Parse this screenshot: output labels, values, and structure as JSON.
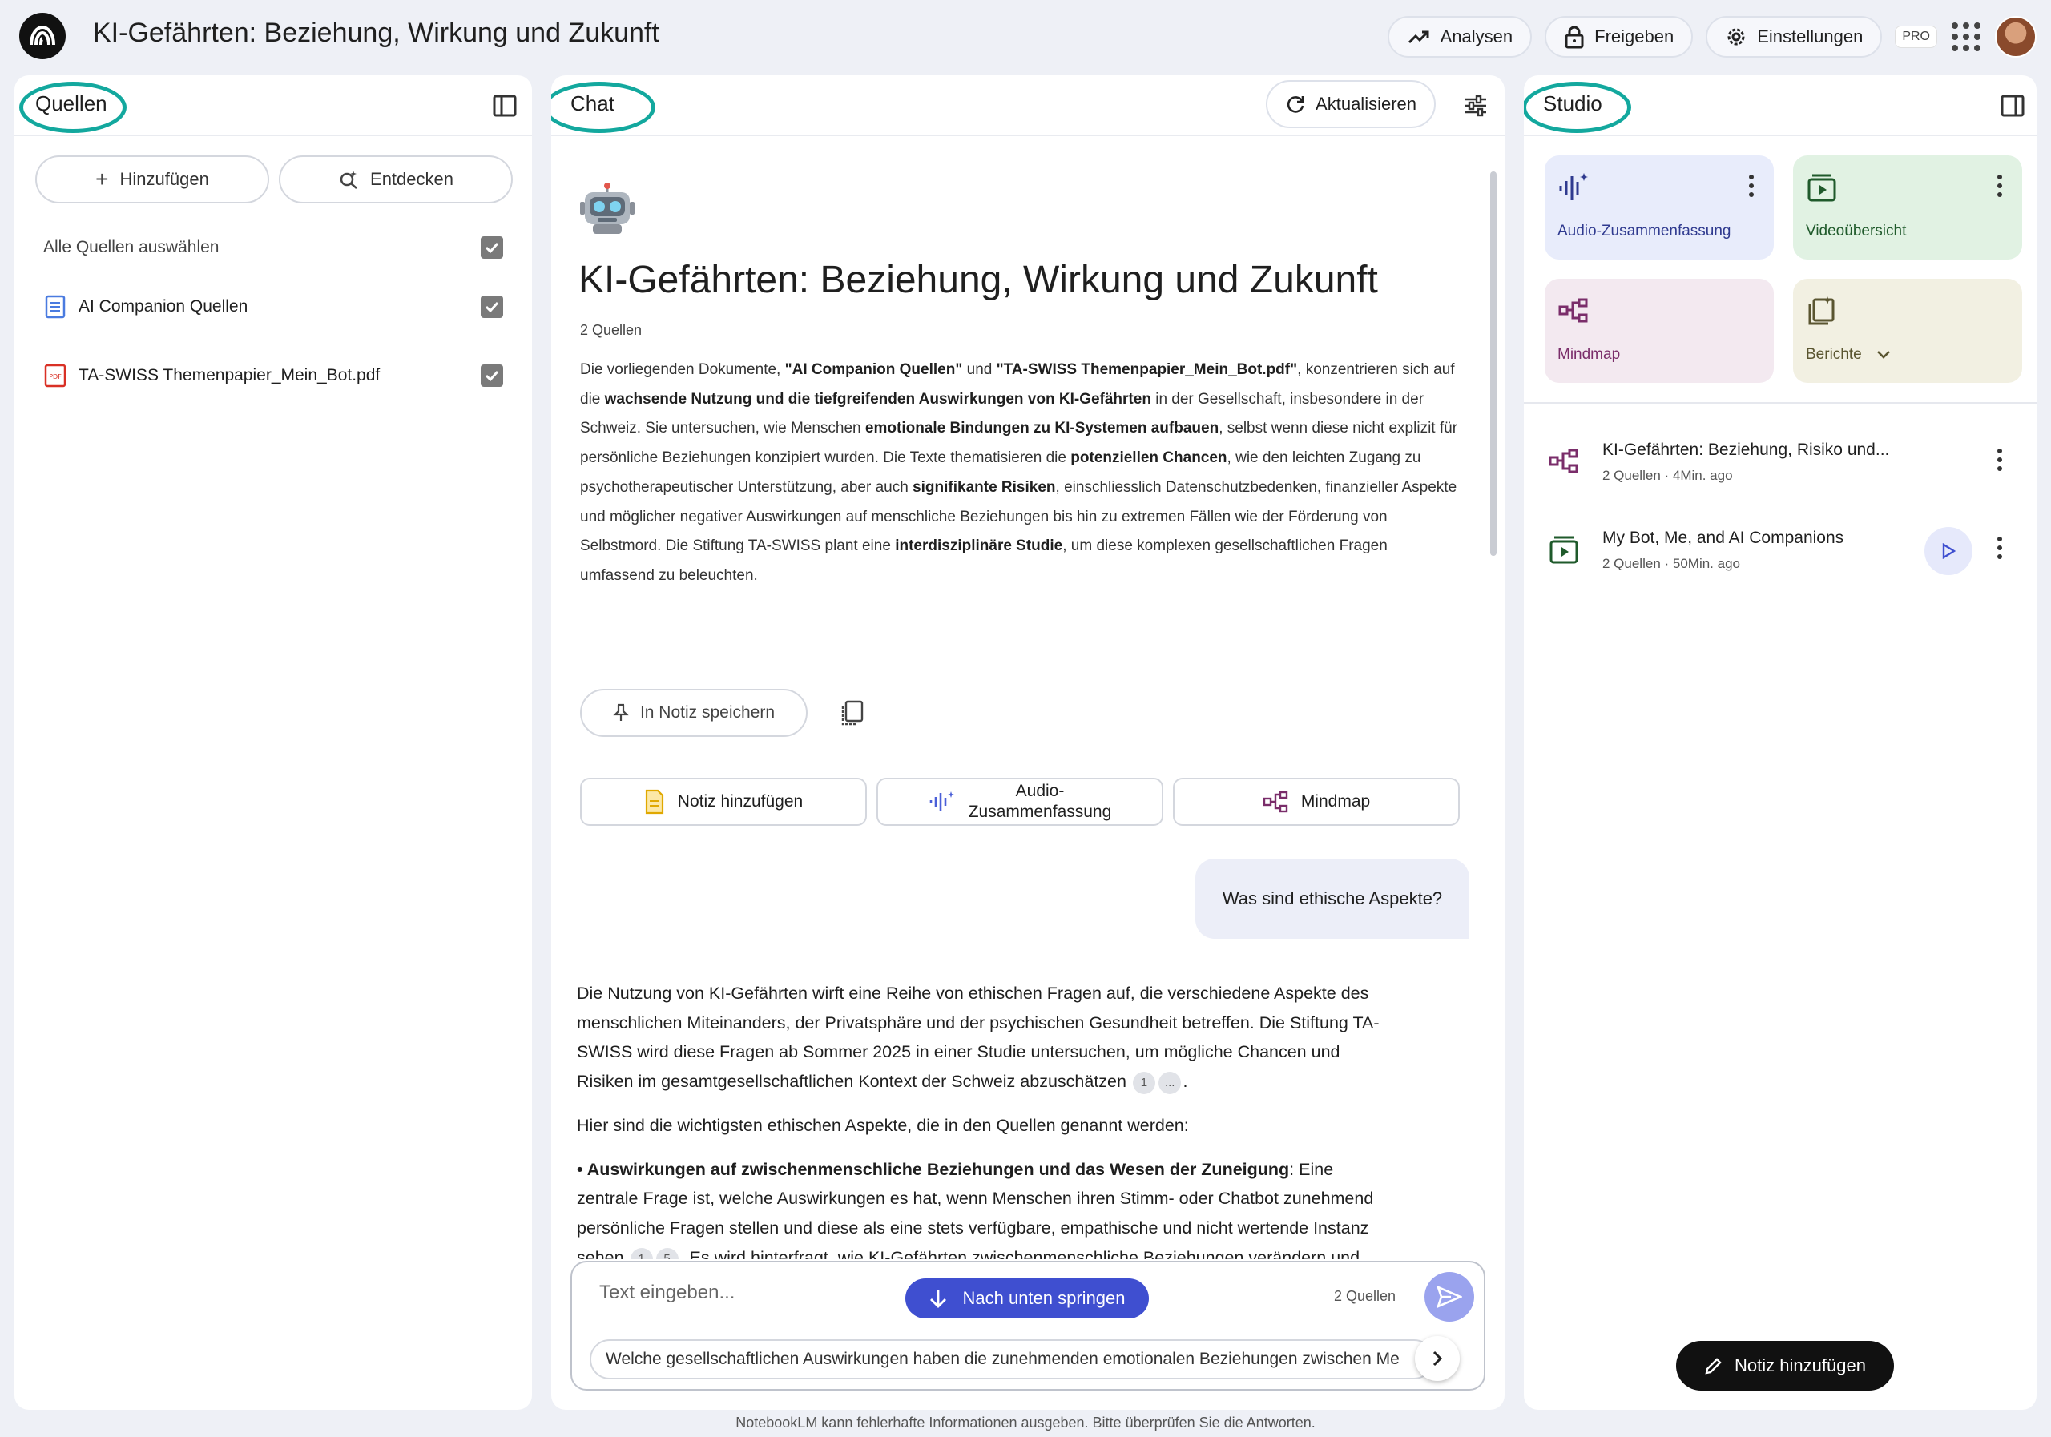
{
  "app": {
    "title": "KI-Gefährten: Beziehung, Wirkung und Zukunft"
  },
  "topbar": {
    "analytics_label": "Analysen",
    "share_label": "Freigeben",
    "settings_label": "Einstellungen",
    "plan_badge": "PRO"
  },
  "sources": {
    "title": "Quellen",
    "add_label": "Hinzufügen",
    "discover_label": "Entdecken",
    "select_all_label": "Alle Quellen auswählen",
    "items": [
      {
        "label": "AI Companion Quellen",
        "icon": "document-icon",
        "checked": true
      },
      {
        "label": "TA-SWISS Themenpapier_Mein_Bot.pdf",
        "icon": "pdf-icon",
        "checked": true
      }
    ]
  },
  "chat": {
    "title": "Chat",
    "refresh_label": "Aktualisieren",
    "notebook_emoji": "robot-icon",
    "notebook_title": "KI-Gefährten: Beziehung, Wirkung und Zukunft",
    "source_count": "2 Quellen",
    "summary": {
      "t1": "Die vorliegenden Dokumente, ",
      "b1": "\"AI Companion Quellen\"",
      "t2": " und ",
      "b2": "\"TA-SWISS Themenpapier_Mein_Bot.pdf\"",
      "t3": ", konzentrieren sich auf die ",
      "b3": "wachsende Nutzung und die tiefgreifenden Auswirkungen von KI-Gefährten",
      "t4": " in der Gesellschaft, insbesondere in der Schweiz. Sie untersuchen, wie Menschen ",
      "b4": "emotionale Bindungen zu KI-Systemen aufbauen",
      "t5": ", selbst wenn diese nicht explizit für persönliche Beziehungen konzipiert wurden. Die Texte thematisieren die ",
      "b5": "potenziellen Chancen",
      "t6": ", wie den leichten Zugang zu psychotherapeutischer Unterstützung, aber auch ",
      "b6": "signifikante Risiken",
      "t7": ", einschliesslich Datenschutzbedenken, finanzieller Aspekte und möglicher negativer Auswirkungen auf menschliche Beziehungen bis hin zu extremen Fällen wie der Förderung von Selbstmord. Die Stiftung TA-SWISS plant eine ",
      "b7": "interdisziplinäre Studie",
      "t8": ", um diese komplexen gesellschaftlichen Fragen umfassend zu beleuchten."
    },
    "save_note_label": "In Notiz speichern",
    "suggestions": [
      {
        "label": "Notiz hinzufügen",
        "icon": "note-icon"
      },
      {
        "label": "Audio-\nZusammenfassung",
        "icon": "audio-icon"
      },
      {
        "label": "Mindmap",
        "icon": "mindmap-icon"
      }
    ],
    "user_question": "Was sind ethische Aspekte?",
    "answer": {
      "p1": "Die Nutzung von KI-Gefährten wirft eine Reihe von ethischen Fragen auf, die verschiedene Aspekte des menschlichen Miteinanders, der Privatsphäre und der psychischen Gesundheit betreffen. Die Stiftung TA-SWISS wird diese Fragen ab Sommer 2025 in einer Studie untersuchen, um mögliche Chancen und Risiken im gesamtgesellschaftlichen Kontext der Schweiz abzuschätzen",
      "p1_cites": [
        "1",
        "..."
      ],
      "p1_end": ".",
      "p2": "Hier sind die wichtigsten ethischen Aspekte, die in den Quellen genannt werden:",
      "p3_bullet": "• ",
      "p3_bold": "Auswirkungen auf zwischenmenschliche Beziehungen und das Wesen der Zuneigung",
      "p3_a": ": Eine zentrale Frage ist, welche Auswirkungen es hat, wenn Menschen ihren Stimm- oder Chatbot zunehmend persönliche Fragen stellen und diese als eine stets verfügbare, empathische und nicht wertende Instanz sehen",
      "p3_cites": [
        "1",
        "5"
      ],
      "p3_b": ". Es wird hinterfragt, wie KI-Gefährten zwischenmenschliche Beziehungen verändern und was Zuneigung zu anderen Menschen künftig bedeutet. Zudem wird untersucht, wie sich Beziehungen zu KI-Systemen auf bestehende oder sich anbahnende zwischenmenschliche Beziehungen im Umfeld von"
    },
    "jump_label": "Nach unten springen",
    "composer_placeholder": "Text eingeben...",
    "composer_source_count": "2 Quellen",
    "followup_suggestion": "Welche gesellschaftlichen Auswirkungen haben die zunehmenden emotionalen Beziehungen zwischen Me"
  },
  "studio": {
    "title": "Studio",
    "tiles": [
      {
        "label": "Audio-Zusammenfassung",
        "icon": "audio-icon",
        "bg": "#e8ecfb",
        "fg": "#2f3a8f"
      },
      {
        "label": "Videoübersicht",
        "icon": "video-icon",
        "bg": "#e1f2e3",
        "fg": "#1f5a2b"
      },
      {
        "label": "Mindmap",
        "icon": "mindmap-icon",
        "bg": "#f3e9f0",
        "fg": "#7a2d6a"
      },
      {
        "label": "Berichte",
        "icon": "report-icon",
        "bg": "#f2f0e2",
        "fg": "#5a5530"
      }
    ],
    "notes": [
      {
        "title": "KI-Gefährten: Beziehung, Risiko und...",
        "meta": "2 Quellen · 4Min. ago",
        "icon": "mindmap-icon"
      },
      {
        "title": "My Bot, Me, and AI Companions",
        "meta": "2 Quellen · 50Min. ago",
        "icon": "video-icon"
      }
    ],
    "add_note_label": "Notiz hinzufügen"
  },
  "footer": {
    "disclaimer": "NotebookLM kann fehlerhafte Informationen ausgeben. Bitte überprüfen Sie die Antworten."
  },
  "colors": {
    "accent": "#3f4fd0",
    "highlight_ring": "#13a89e",
    "background": "#eef0f6"
  }
}
